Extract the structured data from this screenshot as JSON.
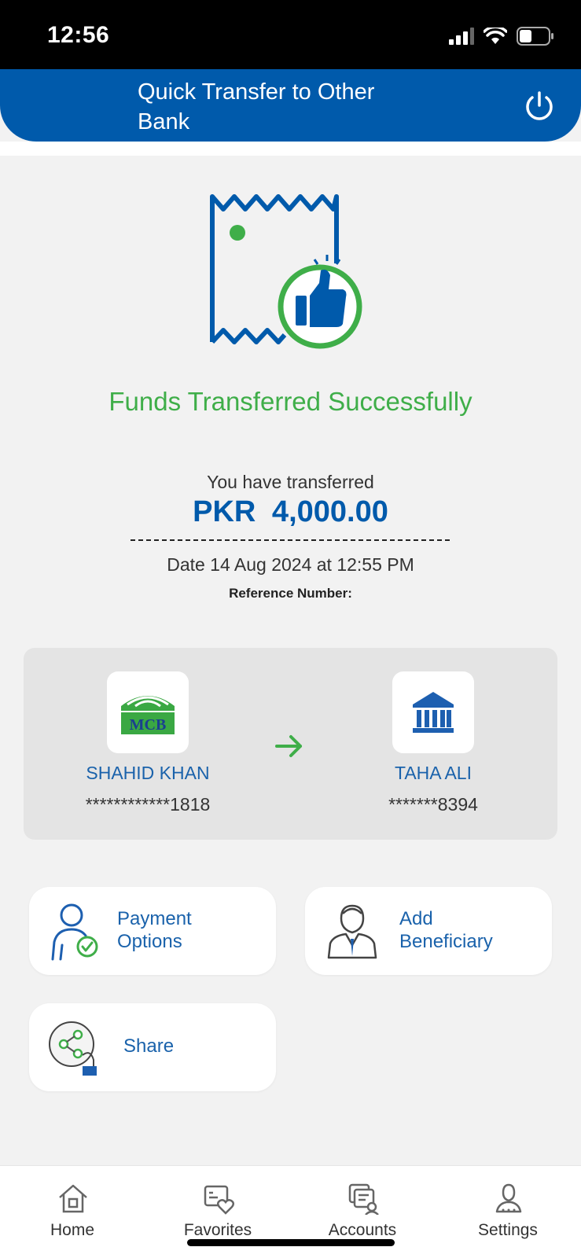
{
  "status_bar": {
    "time": "12:56"
  },
  "header": {
    "title": "Quick Transfer to Other Bank"
  },
  "result": {
    "message": "Funds Transferred Successfully",
    "transferred_label": "You have transferred",
    "amount": "PKR  4,000.00",
    "date": "Date 14 Aug 2024 at 12:55 PM",
    "reference_label": "Reference Number:"
  },
  "transfer": {
    "sender": {
      "bank_logo_text": "MCB",
      "name": "SHAHID KHAN",
      "account": "************1818"
    },
    "receiver": {
      "name": "TAHA ALI",
      "account": "*******8394"
    }
  },
  "actions": {
    "payment_options": "Payment Options",
    "add_beneficiary": "Add Beneficiary",
    "share": "Share"
  },
  "tabbar": {
    "home": "Home",
    "favorites": "Favorites",
    "accounts": "Accounts",
    "settings": "Settings"
  },
  "colors": {
    "brand_blue": "#005aab",
    "success_green": "#3fae49",
    "mcb_green": "#3aa843"
  }
}
